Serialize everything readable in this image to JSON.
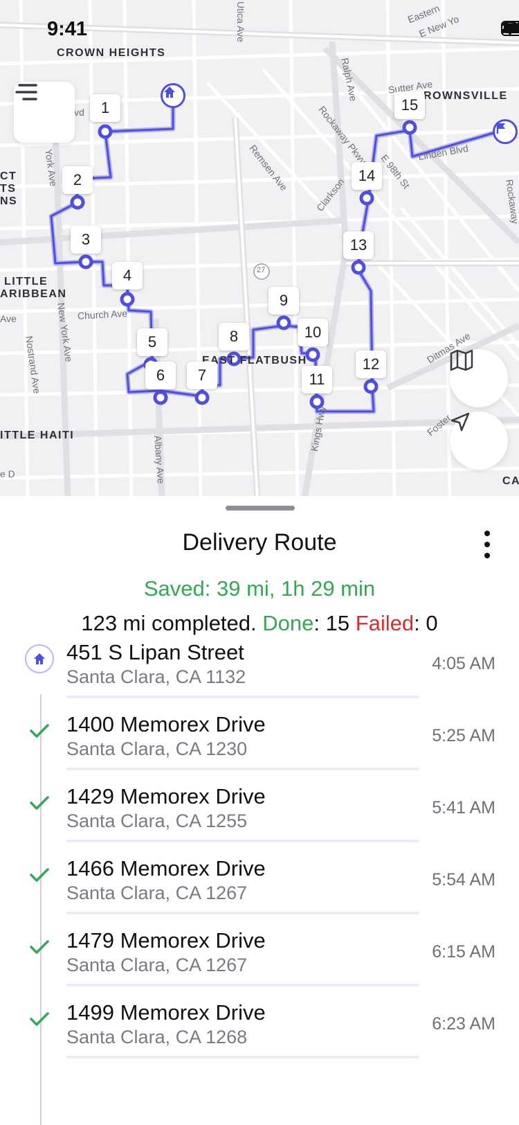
{
  "status_bar": {
    "time": "9:41"
  },
  "map": {
    "areas": [
      "CROWN HEIGHTS",
      "ROWNSVILLE",
      "LITTLE",
      "ARIBBEAN",
      "ITTLE HAITI",
      "EAST FLATBUSH",
      "CT",
      "TS",
      "NS",
      "CA"
    ],
    "streets": [
      "Utica Ave",
      "Ralph Ave",
      "Rockaway Pkwy",
      "Remsen Ave",
      "E 98th St",
      "Clarkson",
      "Sutter Ave",
      "Kings Hwy",
      "Church Ave",
      "New York Ave",
      "Nostrand Ave",
      "Albany Ave",
      "Ditmas Ave",
      "Foster",
      "Linden Blvd",
      "Rockaway",
      "lvd",
      "York Ave",
      "Ave",
      "Eastern",
      "E New Yo",
      "e D",
      "27"
    ],
    "stops": [
      "1",
      "2",
      "3",
      "4",
      "5",
      "6",
      "7",
      "8",
      "9",
      "10",
      "11",
      "12",
      "13",
      "14",
      "15"
    ],
    "route_color": "#4e4ee0",
    "icons": {
      "start": "home-icon",
      "end": "flag-icon"
    }
  },
  "sheet": {
    "title": "Delivery Route",
    "saved": "Saved: 39 mi, 1h 29 min",
    "summary": {
      "completed": "123 mi completed.",
      "done_label": "Done",
      "done_value": ": 15",
      "failed_label": "Failed",
      "failed_value": ": 0"
    },
    "stops": [
      {
        "address": "451 S Lipan Street",
        "city": "Santa Clara, CA 1132",
        "time": "4:05 AM",
        "icon": "home-icon"
      },
      {
        "address": "1400 Memorex Drive",
        "city": "Santa Clara, CA 1230",
        "time": "5:25 AM",
        "icon": "check-icon"
      },
      {
        "address": "1429 Memorex Drive",
        "city": "Santa Clara, CA 1255",
        "time": "5:41 AM",
        "icon": "check-icon"
      },
      {
        "address": "1466 Memorex Drive",
        "city": "Santa Clara, CA 1267",
        "time": "5:54 AM",
        "icon": "check-icon"
      },
      {
        "address": "1479 Memorex Drive",
        "city": "Santa Clara, CA 1267",
        "time": "6:15 AM",
        "icon": "check-icon"
      },
      {
        "address": "1499 Memorex Drive",
        "city": "Santa Clara, CA 1268",
        "time": "6:23 AM",
        "icon": "check-icon"
      }
    ]
  },
  "colors": {
    "accent": "#4e4ee0",
    "success": "#34a853",
    "danger": "#d32f2f"
  }
}
